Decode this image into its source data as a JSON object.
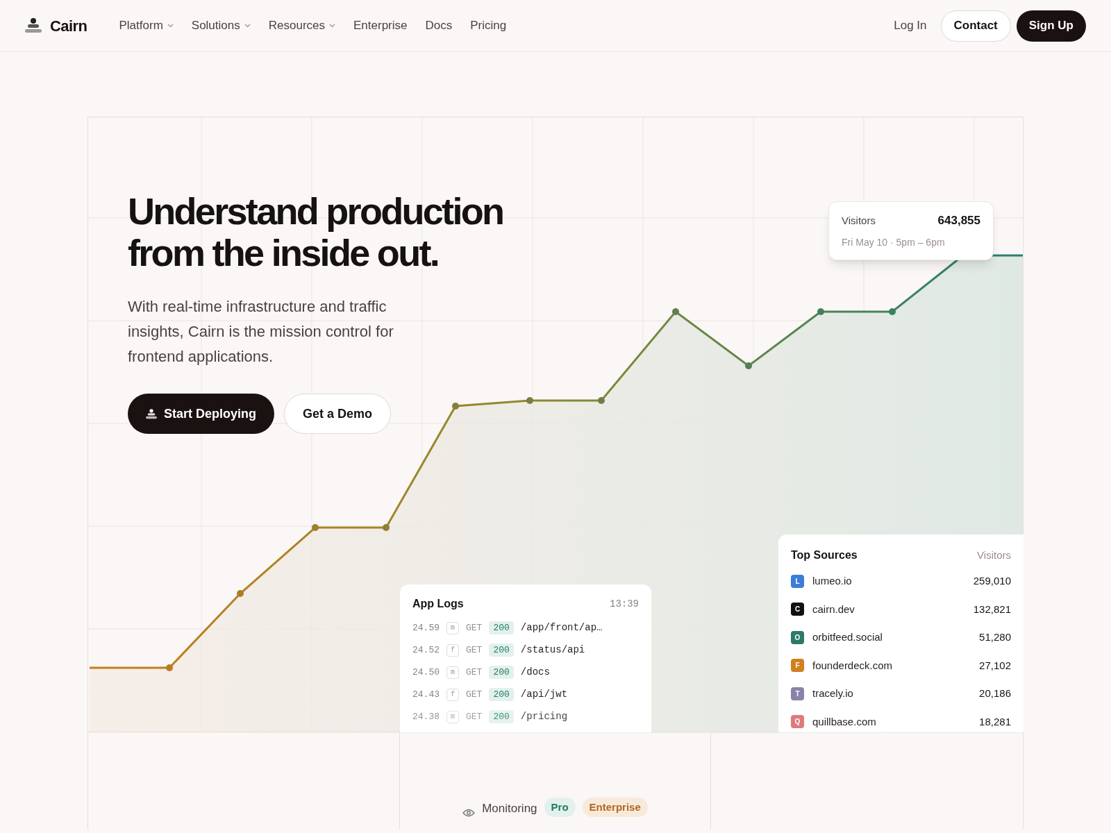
{
  "nav": {
    "logo": "Cairn",
    "links": [
      {
        "label": "Platform",
        "dropdown": true
      },
      {
        "label": "Solutions",
        "dropdown": true
      },
      {
        "label": "Resources",
        "dropdown": true
      },
      {
        "label": "Enterprise",
        "dropdown": false
      },
      {
        "label": "Docs",
        "dropdown": false
      },
      {
        "label": "Pricing",
        "dropdown": false
      }
    ],
    "login": "Log In",
    "contact": "Contact",
    "signup": "Sign Up"
  },
  "hero": {
    "title": "Understand production from the inside out.",
    "description": "With real-time infrastructure and traffic insights, Cairn is the mission control for frontend applications.",
    "primary_button": "Start Deploying",
    "secondary_button": "Get a Demo"
  },
  "tooltip": {
    "label": "Visitors",
    "value": "643,855",
    "time": "Fri May 10 · 5pm – 6pm"
  },
  "app_logs": {
    "title": "App Logs",
    "time": "13:39",
    "rows": [
      {
        "time": "24.59",
        "source": "m",
        "method": "GET",
        "status": "200",
        "path": "/app/front/ap…"
      },
      {
        "time": "24.52",
        "source": "f",
        "method": "GET",
        "status": "200",
        "path": "/status/api"
      },
      {
        "time": "24.50",
        "source": "m",
        "method": "GET",
        "status": "200",
        "path": "/docs"
      },
      {
        "time": "24.43",
        "source": "f",
        "method": "GET",
        "status": "200",
        "path": "/api/jwt"
      },
      {
        "time": "24.38",
        "source": "m",
        "method": "GET",
        "status": "200",
        "path": "/pricing"
      }
    ]
  },
  "top_sources": {
    "title": "Top Sources",
    "column": "Visitors",
    "rows": [
      {
        "initial": "L",
        "name": "lumeo.io",
        "visitors": "259,010",
        "color": "#3b7dd8"
      },
      {
        "initial": "C",
        "name": "cairn.dev",
        "visitors": "132,821",
        "color": "#111111"
      },
      {
        "initial": "O",
        "name": "orbitfeed.social",
        "visitors": "51,280",
        "color": "#2b7a6a"
      },
      {
        "initial": "F",
        "name": "founderdeck.com",
        "visitors": "27,102",
        "color": "#d0801f"
      },
      {
        "initial": "T",
        "name": "tracely.io",
        "visitors": "20,186",
        "color": "#8a83a8"
      },
      {
        "initial": "Q",
        "name": "quillbase.com",
        "visitors": "18,281",
        "color": "#e07a7a"
      }
    ]
  },
  "feature": {
    "label": "Monitoring",
    "badges": [
      {
        "label": "Pro",
        "kind": "pro"
      },
      {
        "label": "Enterprise",
        "kind": "enterprise"
      }
    ]
  }
}
